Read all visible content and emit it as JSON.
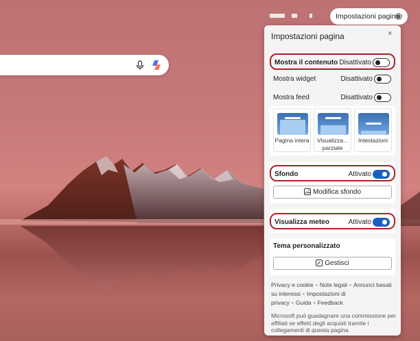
{
  "top_bar": {
    "settings_button_label": "Impostazioni pagina"
  },
  "panel": {
    "title": "Impostazioni pagina",
    "close_glyph": "×",
    "toggles": [
      {
        "label": "Mostra il contenuto",
        "state": "Disattivato",
        "on": false
      },
      {
        "label": "Mostra widget",
        "state": "Disattivato",
        "on": false
      },
      {
        "label": "Mostra feed",
        "state": "Disattivato",
        "on": false
      }
    ],
    "layouts": [
      {
        "label": "Pagina intera"
      },
      {
        "label": "Visualizza... parziale"
      },
      {
        "label": "Intestazioni"
      }
    ],
    "background": {
      "label": "Sfondo",
      "state": "Attivato",
      "on": true,
      "button_label": "Modifica sfondo"
    },
    "weather": {
      "label": "Visualizza meteo",
      "state": "Attivato",
      "on": true
    },
    "theme": {
      "title": "Tema personalizzato",
      "button_label": "Gestisci"
    },
    "footer_links": [
      "Privacy e cookie",
      "Note legali",
      "Annunci basati su interessi",
      "Impostazioni di privacy",
      "Guida",
      "Feedback"
    ],
    "disclaimer": "Microsoft può guadagnare una commissione per affiliati se effetti degli acquisti tramite i collegamenti di questa pagina."
  },
  "colors": {
    "accent": "#1a5fc0",
    "highlight": "#a8202a"
  }
}
